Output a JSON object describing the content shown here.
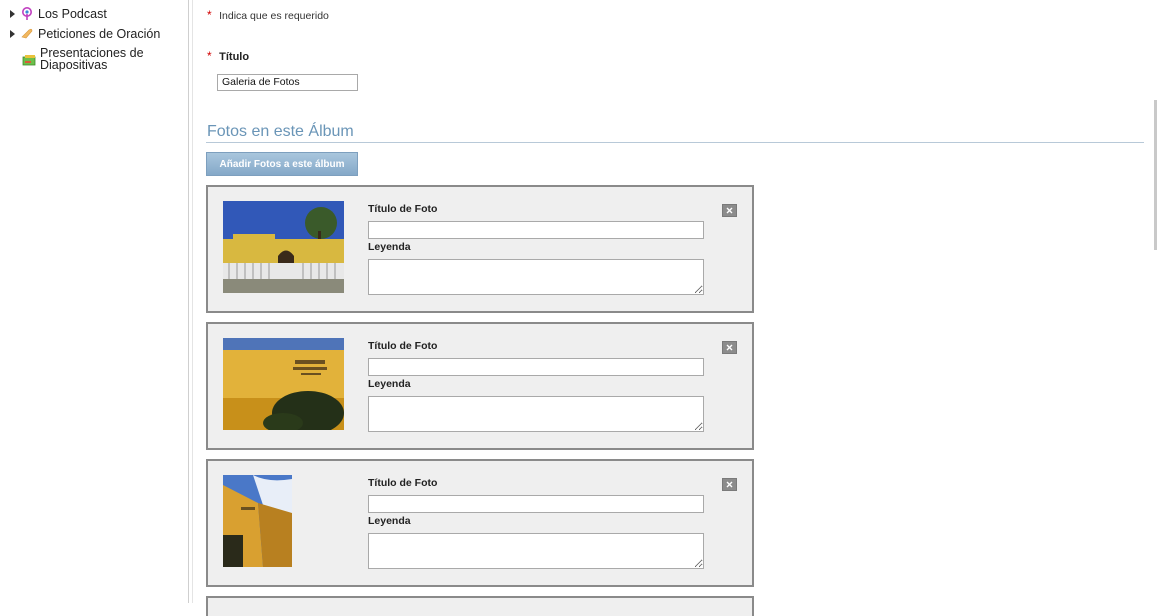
{
  "sidebar": {
    "items": [
      {
        "label": "Los Podcast",
        "icon": "podcast-icon",
        "expandable": true
      },
      {
        "label": "Peticiones de Oración",
        "icon": "prayer-hands-icon",
        "expandable": true
      },
      {
        "label": "Presentaciones de Diapositivas",
        "icon": "slideshow-icon",
        "expandable": false
      }
    ]
  },
  "form": {
    "required_note": "Indica que es requerido",
    "required_marker": "*",
    "title_label": "Título",
    "title_value": "Galeria de Fotos"
  },
  "photos_section": {
    "heading": "Fotos en este Álbum",
    "add_button_label": "Añadir Fotos a este álbum",
    "photos": [
      {
        "title_label": "Título de Foto",
        "title_value": "",
        "caption_label": "Leyenda",
        "caption_value": "",
        "thumb": "building-front-photo"
      },
      {
        "title_label": "Título de Foto",
        "title_value": "",
        "caption_label": "Leyenda",
        "caption_value": "",
        "thumb": "wall-sign-photo"
      },
      {
        "title_label": "Título de Foto",
        "title_value": "",
        "caption_label": "Leyenda",
        "caption_value": "",
        "thumb": "building-corner-photo"
      }
    ]
  },
  "colors": {
    "accent": "#6a95b7",
    "required": "#d20000",
    "card_bg": "#efefef",
    "card_border": "#8a8a8a"
  }
}
